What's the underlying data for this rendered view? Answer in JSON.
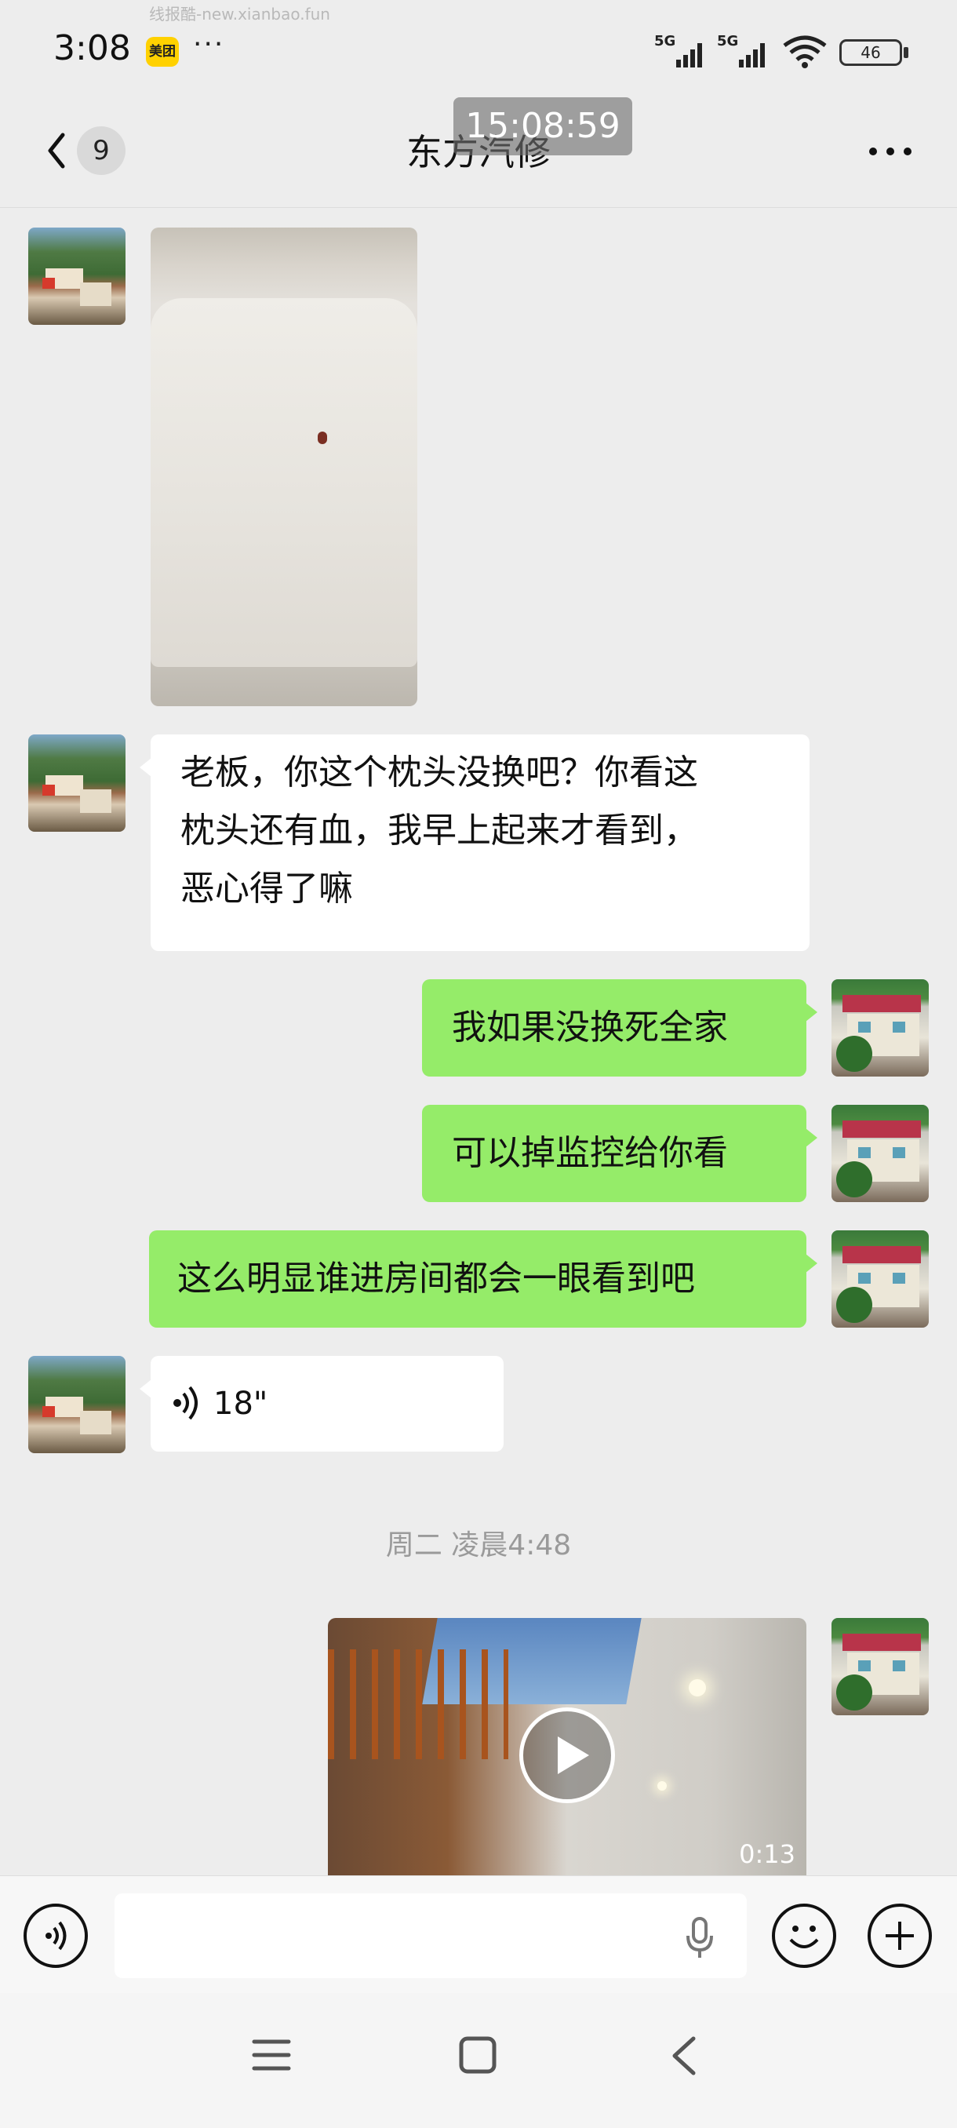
{
  "status_bar": {
    "watermark": "线报酷-new.xianbao.fun",
    "time": "3:08",
    "app_badge": "美团",
    "more": "···",
    "signal1": "5G",
    "signal2": "5G",
    "battery": "46"
  },
  "header": {
    "back_count": "9",
    "title": "东方汽修",
    "overlay_time": "15:08:59"
  },
  "messages": [
    {
      "side": "left",
      "type": "image"
    },
    {
      "side": "left",
      "type": "text",
      "lines": [
        "老板，你这个枕头没换吧？你看这",
        "枕头还有血，我早上起来才看到，",
        "恶心得了嘛"
      ]
    },
    {
      "side": "right",
      "type": "text",
      "text": "我如果没换死全家"
    },
    {
      "side": "right",
      "type": "text",
      "text": "可以掉监控给你看"
    },
    {
      "side": "right",
      "type": "text",
      "text": "这么明显谁进房间都会一眼看到吧"
    },
    {
      "side": "left",
      "type": "voice",
      "duration": "18\""
    },
    {
      "type": "timestamp",
      "text": "周二 凌晨4:48"
    },
    {
      "side": "right",
      "type": "video",
      "duration": "0:13"
    }
  ],
  "input_bar": {
    "value": "",
    "placeholder": ""
  },
  "icons": {
    "back": "chevron-left-icon",
    "more": "more-dots-icon",
    "voice_toggle": "voice-icon",
    "mic": "mic-icon",
    "emoji": "emoji-icon",
    "plus": "plus-icon",
    "menu": "menu-icon",
    "home": "home-icon",
    "sys_back": "back-icon"
  },
  "colors": {
    "background": "#ededed",
    "bubble_self": "#95ec69",
    "bubble_other": "#ffffff"
  }
}
